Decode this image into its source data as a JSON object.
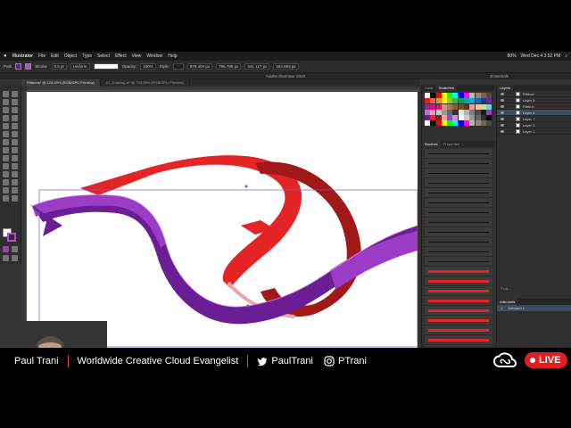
{
  "menubar": {
    "items": [
      "Illustrator",
      "File",
      "Edit",
      "Object",
      "Type",
      "Select",
      "Effect",
      "View",
      "Window",
      "Help"
    ],
    "datetime": "Wed Dec 4  3:52 PM",
    "battery": "80%"
  },
  "controlbar": {
    "selection_label": "Path",
    "stroke_label": "Stroke:",
    "stroke_value": "0.5 pt",
    "stroke_profile": "Uniform",
    "opacity_label": "Opacity:",
    "opacity_value": "100%",
    "style_label": "Style:",
    "x_value": "979.404 px",
    "y_value": "796.789 px",
    "w_value": "441.117 px",
    "h_value": "154.883 px"
  },
  "window": {
    "title": "Adobe Illustrator 2020",
    "workspace": "Essentials"
  },
  "document_tabs": [
    {
      "label": "Ribbons* @ 124.15% (RGB/GPU Preview)",
      "active": true
    },
    {
      "label": "01_Drawing.ai* @ 723.25% (RGB/GPU Preview)",
      "active": false
    }
  ],
  "panels": {
    "color_tabs": [
      "Color",
      "Swatches"
    ],
    "brush_tabs": [
      "Brushes",
      "Properties"
    ],
    "layers_tab": "Layers",
    "layers": [
      {
        "name": "Ribbon",
        "selected": false
      },
      {
        "name": "Layer 5",
        "selected": false
      },
      {
        "name": "Ribbon",
        "selected": false
      },
      {
        "name": "Layer 4",
        "selected": true
      },
      {
        "name": "Layer 7",
        "selected": false
      },
      {
        "name": "Layer 3",
        "selected": false
      },
      {
        "name": "Layer 1",
        "selected": false
      }
    ],
    "layers_count": "7 La...",
    "artboards_tab": "Artboards",
    "artboards": [
      {
        "index": "1",
        "name": "Artboard 1"
      }
    ]
  },
  "colors": {
    "purple": "#6a1d94",
    "purple_light": "#9b3dc4",
    "red": "#e52525",
    "dark_red": "#a01818",
    "selection": "#7b56c8"
  },
  "lower_third": {
    "name": "Paul Trani",
    "title": "Worldwide Creative Cloud Evangelist",
    "twitter_handle": "PaulTrani",
    "instagram_handle": "PTrani",
    "live_label": "LIVE"
  }
}
